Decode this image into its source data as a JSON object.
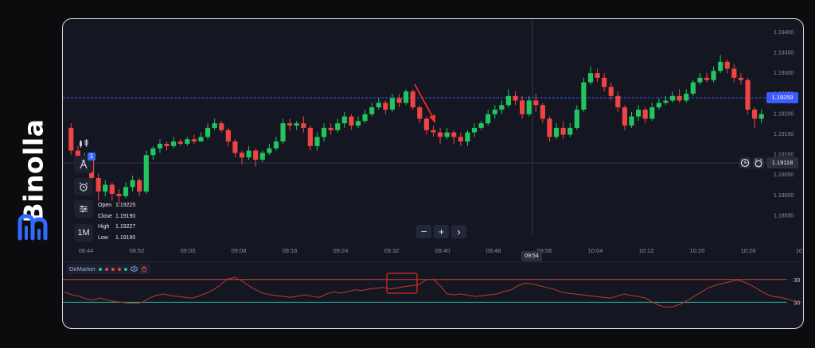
{
  "brand": {
    "name": "Binolla"
  },
  "colors": {
    "bull": "#22c55e",
    "bear": "#ef4444",
    "bg": "#141722",
    "accent": "#3d5afe",
    "overbought": "#d24040",
    "oversold": "#2bbf9f",
    "demarker_line": "#c0392b"
  },
  "price_axis": {
    "ticks": [
      "1.19400",
      "1.19350",
      "1.19300",
      "1.19250",
      "1.19200",
      "1.19150",
      "1.19100",
      "1.19050",
      "1.19000",
      "1.18950"
    ]
  },
  "time_axis": {
    "ticks": [
      "08:44",
      "08:52",
      "09:00",
      "09:08",
      "09:16",
      "09:24",
      "09:32",
      "09:40",
      "09:48",
      "09:56",
      "10:04",
      "10:12",
      "10:20",
      "10:28",
      "10"
    ]
  },
  "current_price": "1.19259",
  "crosshair": {
    "price": "1.19118",
    "time": "09:54"
  },
  "ohlc": {
    "rows": [
      {
        "label": "Open",
        "value": "1.19225"
      },
      {
        "label": "Close",
        "value": "1.19190"
      },
      {
        "label": "High",
        "value": "1.19227"
      },
      {
        "label": "Low",
        "value": "1.19190"
      }
    ]
  },
  "toolbar": {
    "drawing_badge": "1",
    "timeframe": "1M"
  },
  "zoom": {
    "minus": "−",
    "plus": "+",
    "next": "›"
  },
  "indicator": {
    "name": "DeMarker",
    "upper_label": "30",
    "lower_label": "30"
  },
  "chart_data": {
    "type": "candlestick",
    "x_range": [
      "08:40",
      "10:33"
    ],
    "y_range": [
      1.18945,
      1.19425
    ],
    "candles": [
      [
        1.192,
        1.1915,
        1.1921,
        1.1914
      ],
      [
        1.1915,
        1.1912,
        1.1916,
        1.191
      ],
      [
        1.1912,
        1.19135,
        1.19145,
        1.1911
      ],
      [
        1.19135,
        1.1909,
        1.1914,
        1.1908
      ],
      [
        1.1909,
        1.1906,
        1.191,
        1.1904
      ],
      [
        1.1906,
        1.19075,
        1.19085,
        1.1905
      ],
      [
        1.19075,
        1.19055,
        1.1908,
        1.1904
      ],
      [
        1.19055,
        1.1905,
        1.19065,
        1.1903
      ],
      [
        1.1905,
        1.1907,
        1.1908,
        1.19045
      ],
      [
        1.1907,
        1.19085,
        1.19095,
        1.1906
      ],
      [
        1.19085,
        1.1906,
        1.1909,
        1.1905
      ],
      [
        1.1906,
        1.1914,
        1.1915,
        1.19055
      ],
      [
        1.1914,
        1.19155,
        1.1916,
        1.1913
      ],
      [
        1.19155,
        1.19165,
        1.19175,
        1.19145
      ],
      [
        1.19165,
        1.1916,
        1.1917,
        1.1915
      ],
      [
        1.1916,
        1.1917,
        1.1918,
        1.19155
      ],
      [
        1.1917,
        1.19165,
        1.19175,
        1.1916
      ],
      [
        1.19165,
        1.19175,
        1.1918,
        1.1916
      ],
      [
        1.19175,
        1.1917,
        1.19185,
        1.19165
      ],
      [
        1.1917,
        1.1918,
        1.1919,
        1.1917
      ],
      [
        1.1918,
        1.192,
        1.1921,
        1.19175
      ],
      [
        1.192,
        1.1921,
        1.1922,
        1.19195
      ],
      [
        1.1921,
        1.19195,
        1.19215,
        1.1919
      ],
      [
        1.19195,
        1.1917,
        1.192,
        1.1916
      ],
      [
        1.1917,
        1.19145,
        1.19175,
        1.19135
      ],
      [
        1.19145,
        1.19135,
        1.1915,
        1.1912
      ],
      [
        1.19135,
        1.1915,
        1.1916,
        1.1913
      ],
      [
        1.1915,
        1.1913,
        1.19155,
        1.19115
      ],
      [
        1.1913,
        1.19145,
        1.1915,
        1.19125
      ],
      [
        1.19145,
        1.19155,
        1.19165,
        1.1914
      ],
      [
        1.19155,
        1.1917,
        1.1918,
        1.1915
      ],
      [
        1.1917,
        1.1921,
        1.1922,
        1.19165
      ],
      [
        1.1921,
        1.19205,
        1.1922,
        1.19195
      ],
      [
        1.19205,
        1.1921,
        1.19215,
        1.19195
      ],
      [
        1.1921,
        1.192,
        1.19225,
        1.1919
      ],
      [
        1.192,
        1.1916,
        1.19205,
        1.1915
      ],
      [
        1.1916,
        1.1918,
        1.1919,
        1.1915
      ],
      [
        1.1918,
        1.192,
        1.1921,
        1.1917
      ],
      [
        1.192,
        1.19195,
        1.1921,
        1.19185
      ],
      [
        1.19195,
        1.1921,
        1.1922,
        1.1919
      ],
      [
        1.1921,
        1.19225,
        1.19235,
        1.192
      ],
      [
        1.19225,
        1.19205,
        1.1923,
        1.19195
      ],
      [
        1.19205,
        1.19215,
        1.19225,
        1.192
      ],
      [
        1.19215,
        1.1923,
        1.1924,
        1.1921
      ],
      [
        1.1923,
        1.19245,
        1.19255,
        1.19225
      ],
      [
        1.19245,
        1.19255,
        1.19265,
        1.1924
      ],
      [
        1.19255,
        1.1924,
        1.1926,
        1.1923
      ],
      [
        1.1924,
        1.19265,
        1.19275,
        1.19235
      ],
      [
        1.19265,
        1.19255,
        1.19275,
        1.19245
      ],
      [
        1.19255,
        1.1928,
        1.19285,
        1.1925
      ],
      [
        1.1928,
        1.19245,
        1.19285,
        1.1924
      ],
      [
        1.19245,
        1.1922,
        1.1925,
        1.1921
      ],
      [
        1.1922,
        1.19195,
        1.19225,
        1.19185
      ],
      [
        1.19195,
        1.1919,
        1.19205,
        1.1918
      ],
      [
        1.1919,
        1.1918,
        1.192,
        1.19165
      ],
      [
        1.1918,
        1.1919,
        1.192,
        1.19175
      ],
      [
        1.1919,
        1.1918,
        1.19195,
        1.19165
      ],
      [
        1.1918,
        1.1917,
        1.1919,
        1.1916
      ],
      [
        1.1917,
        1.1919,
        1.19195,
        1.1916
      ],
      [
        1.1919,
        1.192,
        1.1921,
        1.1918
      ],
      [
        1.192,
        1.1921,
        1.19215,
        1.19195
      ],
      [
        1.1921,
        1.1923,
        1.1924,
        1.19205
      ],
      [
        1.1923,
        1.1924,
        1.1925,
        1.1922
      ],
      [
        1.1924,
        1.1925,
        1.1926,
        1.1923
      ],
      [
        1.1925,
        1.1927,
        1.19285,
        1.19245
      ],
      [
        1.1927,
        1.1926,
        1.1928,
        1.1925
      ],
      [
        1.1926,
        1.1923,
        1.1927,
        1.1922
      ],
      [
        1.1923,
        1.1926,
        1.1927,
        1.19225
      ],
      [
        1.1926,
        1.1925,
        1.19275,
        1.19235
      ],
      [
        1.1925,
        1.1922,
        1.19255,
        1.1921
      ],
      [
        1.1922,
        1.1918,
        1.19225,
        1.1917
      ],
      [
        1.1918,
        1.192,
        1.1921,
        1.19175
      ],
      [
        1.192,
        1.19185,
        1.19215,
        1.19175
      ],
      [
        1.19185,
        1.192,
        1.1921,
        1.1918
      ],
      [
        1.192,
        1.1924,
        1.1925,
        1.19195
      ],
      [
        1.1924,
        1.193,
        1.1931,
        1.19235
      ],
      [
        1.193,
        1.1932,
        1.19335,
        1.19295
      ],
      [
        1.1932,
        1.1931,
        1.1933,
        1.193
      ],
      [
        1.1931,
        1.1929,
        1.1932,
        1.1928
      ],
      [
        1.1929,
        1.1927,
        1.193,
        1.1926
      ],
      [
        1.1927,
        1.19245,
        1.1928,
        1.19235
      ],
      [
        1.19245,
        1.19205,
        1.1925,
        1.19195
      ],
      [
        1.19205,
        1.19225,
        1.19235,
        1.192
      ],
      [
        1.19225,
        1.1924,
        1.1925,
        1.19215
      ],
      [
        1.1924,
        1.1922,
        1.19245,
        1.1921
      ],
      [
        1.1922,
        1.19245,
        1.19255,
        1.19215
      ],
      [
        1.19245,
        1.19255,
        1.19265,
        1.1924
      ],
      [
        1.19255,
        1.1926,
        1.1927,
        1.1925
      ],
      [
        1.1926,
        1.1927,
        1.1928,
        1.19255
      ],
      [
        1.1927,
        1.1926,
        1.19285,
        1.19255
      ],
      [
        1.1926,
        1.19275,
        1.19285,
        1.19255
      ],
      [
        1.19275,
        1.193,
        1.19305,
        1.1927
      ],
      [
        1.193,
        1.1931,
        1.1932,
        1.19295
      ],
      [
        1.1931,
        1.19305,
        1.1932,
        1.193
      ],
      [
        1.19305,
        1.19325,
        1.19335,
        1.193
      ],
      [
        1.19325,
        1.19345,
        1.1936,
        1.1932
      ],
      [
        1.19345,
        1.1933,
        1.1935,
        1.1932
      ],
      [
        1.1933,
        1.1931,
        1.1934,
        1.193
      ],
      [
        1.1931,
        1.19305,
        1.1932,
        1.19295
      ],
      [
        1.19305,
        1.1924,
        1.1931,
        1.1923
      ],
      [
        1.1924,
        1.1922,
        1.19245,
        1.192
      ],
      [
        1.1922,
        1.1923,
        1.1924,
        1.1921
      ]
    ],
    "demarker": [
      0.55,
      0.48,
      0.45,
      0.38,
      0.35,
      0.4,
      0.36,
      0.32,
      0.3,
      0.28,
      0.27,
      0.3,
      0.4,
      0.47,
      0.5,
      0.46,
      0.44,
      0.42,
      0.4,
      0.45,
      0.52,
      0.6,
      0.72,
      0.86,
      0.9,
      0.82,
      0.7,
      0.6,
      0.52,
      0.48,
      0.46,
      0.44,
      0.42,
      0.45,
      0.48,
      0.44,
      0.42,
      0.5,
      0.55,
      0.52,
      0.56,
      0.6,
      0.58,
      0.62,
      0.64,
      0.66,
      0.62,
      0.65,
      0.68,
      0.7,
      0.72,
      0.84,
      0.86,
      0.7,
      0.5,
      0.48,
      0.5,
      0.47,
      0.44,
      0.46,
      0.48,
      0.5,
      0.56,
      0.6,
      0.7,
      0.76,
      0.74,
      0.7,
      0.66,
      0.62,
      0.55,
      0.52,
      0.5,
      0.48,
      0.46,
      0.44,
      0.42,
      0.4,
      0.45,
      0.5,
      0.46,
      0.44,
      0.4,
      0.3,
      0.22,
      0.18,
      0.2,
      0.26,
      0.35,
      0.46,
      0.56,
      0.66,
      0.72,
      0.76,
      0.8,
      0.84,
      0.78,
      0.7,
      0.6,
      0.5,
      0.44,
      0.42,
      0.38,
      0.32,
      0.3
    ],
    "demarker_levels": {
      "upper": 0.85,
      "lower": 0.3
    }
  }
}
